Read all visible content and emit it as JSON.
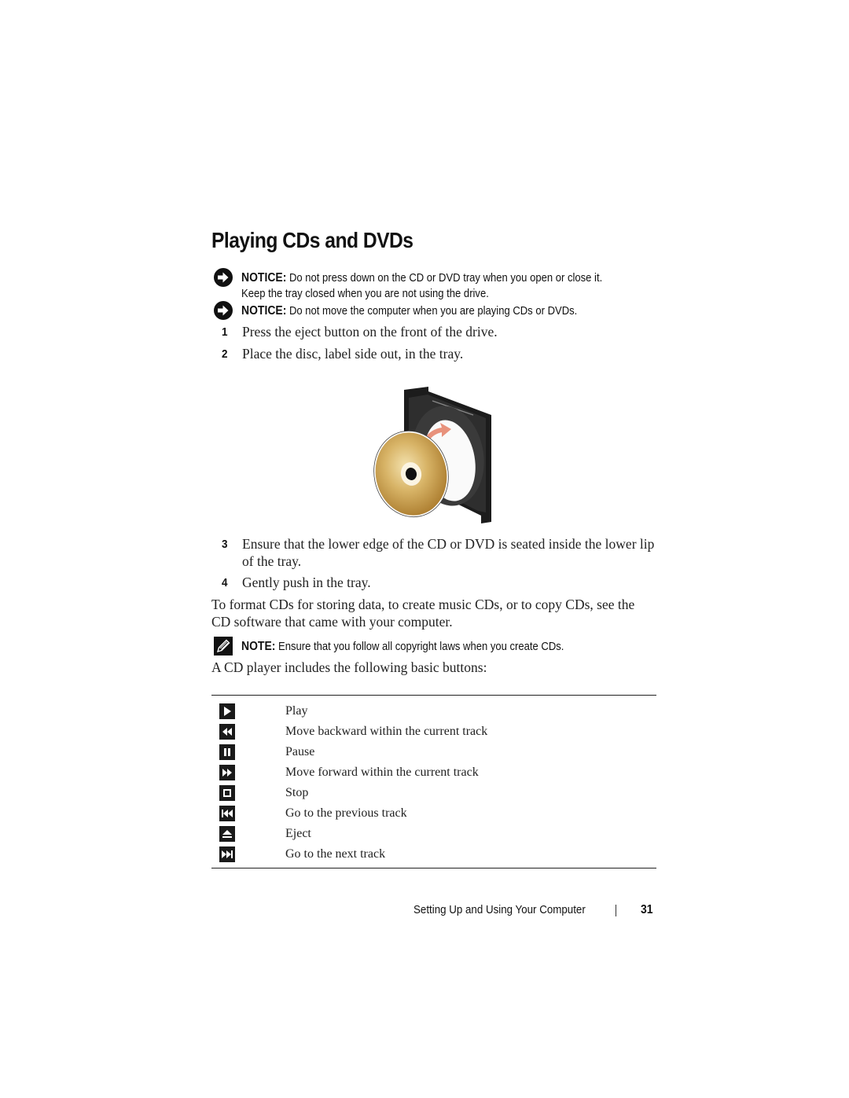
{
  "page": {
    "title": "Playing CDs and DVDs",
    "notices": [
      {
        "icon": "notice-arrow-icon",
        "label": "NOTICE:",
        "lines": [
          "Do not press down on the CD or DVD tray when you open or close it.",
          "Keep the tray closed when you are not using the drive."
        ]
      },
      {
        "icon": "notice-arrow-icon",
        "label": "NOTICE:",
        "lines": [
          "Do not move the computer when you are playing CDs or DVDs."
        ]
      }
    ],
    "steps": [
      {
        "num": "1",
        "text": "Press the eject button on the front of the drive."
      },
      {
        "num": "2",
        "text": "Place the disc, label side out, in the tray."
      },
      {
        "num": "3",
        "lines": [
          "Ensure that the lower edge of the CD or DVD is seated inside the lower lip",
          "of the tray."
        ]
      },
      {
        "num": "4",
        "text": "Gently push in the tray."
      }
    ],
    "figure": {
      "icon": "disc-tray-illustration",
      "arrow_color": "#e8927c",
      "disc_color": "#c9a04a"
    },
    "paragraph": [
      "To format CDs for storing data, to create music CDs, or to copy CDs, see the",
      "CD software that came with your computer."
    ],
    "note": {
      "icon": "note-pencil-icon",
      "label": "NOTE:",
      "text": "Ensure that you follow all copyright laws when you create CDs."
    },
    "intro": "A CD player includes the following basic buttons:",
    "buttons": [
      {
        "icon": "play-icon",
        "label": "Play"
      },
      {
        "icon": "rewind-icon",
        "label": "Move backward within the current track"
      },
      {
        "icon": "pause-icon",
        "label": "Pause"
      },
      {
        "icon": "fast-forward-icon",
        "label": "Move forward within the current track"
      },
      {
        "icon": "stop-icon",
        "label": "Stop"
      },
      {
        "icon": "previous-track-icon",
        "label": "Go to the previous track"
      },
      {
        "icon": "eject-icon",
        "label": "Eject"
      },
      {
        "icon": "next-track-icon",
        "label": "Go to the next track"
      }
    ],
    "footer": {
      "section": "Setting Up and Using Your Computer",
      "page_number": "31"
    }
  }
}
